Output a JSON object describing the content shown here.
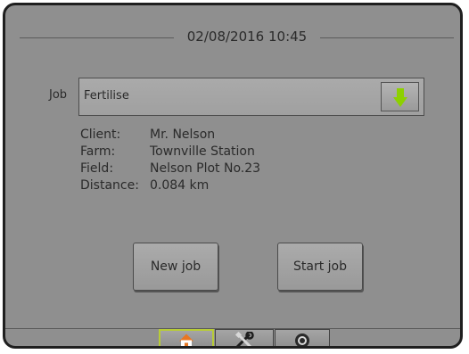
{
  "header": {
    "datetime": "02/08/2016 10:45"
  },
  "job": {
    "label": "Job",
    "value": "Fertilise"
  },
  "details": [
    {
      "label": "Client:",
      "value": "Mr. Nelson"
    },
    {
      "label": "Farm:",
      "value": "Townville Station"
    },
    {
      "label": "Field:",
      "value": "Nelson Plot No.23"
    },
    {
      "label": "Distance:",
      "value": "0.084 km"
    }
  ],
  "actions": {
    "new_job": "New job",
    "start_job": "Start job"
  },
  "nav": {
    "tabs": [
      {
        "icon": "home-icon"
      },
      {
        "icon": "tools-icon"
      },
      {
        "icon": "camera-icon"
      }
    ]
  },
  "colors": {
    "background": "#8f8f8f",
    "accent_arrow": "#8dd000",
    "active_tab_border": "#b8cc37"
  }
}
